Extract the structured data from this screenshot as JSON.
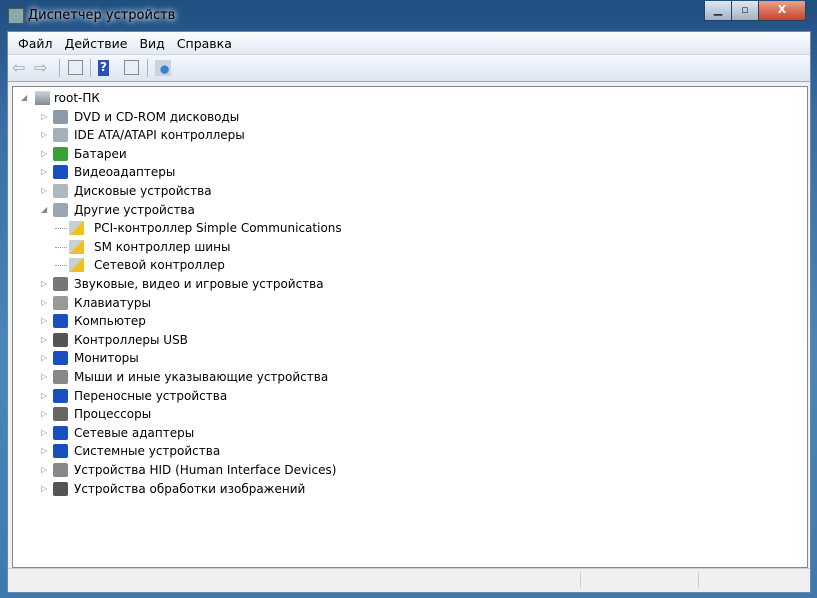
{
  "window": {
    "title": "Диспетчер устройств"
  },
  "menu": [
    "Файл",
    "Действие",
    "Вид",
    "Справка"
  ],
  "toolbar": {
    "icons": [
      "back-icon",
      "forward-icon",
      "console-tree-icon",
      "help-icon",
      "action-pane-icon",
      "scan-hardware-icon"
    ]
  },
  "tree": {
    "root": "root-ПК",
    "items": [
      {
        "label": "DVD и CD-ROM дисководы",
        "icon": "dvd",
        "color": "#8a9aa8"
      },
      {
        "label": "IDE ATA/ATAPI контроллеры",
        "icon": "ide",
        "color": "#a6b0b8"
      },
      {
        "label": "Батареи",
        "icon": "battery",
        "color": "#3aa03a"
      },
      {
        "label": "Видеоадаптеры",
        "icon": "display",
        "color": "#1a4fc0"
      },
      {
        "label": "Дисковые устройства",
        "icon": "disk",
        "color": "#b0b8bf"
      },
      {
        "label": "Другие устройства",
        "icon": "unknown",
        "color": "#9aa6b0",
        "expanded": true,
        "children": [
          "PCI-контроллер Simple Communications",
          "SM контроллер шины",
          "Сетевой контроллер"
        ]
      },
      {
        "label": "Звуковые, видео и игровые устройства",
        "icon": "sound",
        "color": "#777"
      },
      {
        "label": "Клавиатуры",
        "icon": "keyboard",
        "color": "#999"
      },
      {
        "label": "Компьютер",
        "icon": "computer",
        "color": "#1a4fc0"
      },
      {
        "label": "Контроллеры USB",
        "icon": "usb",
        "color": "#555"
      },
      {
        "label": "Мониторы",
        "icon": "monitor",
        "color": "#1a4fc0"
      },
      {
        "label": "Мыши и иные указывающие устройства",
        "icon": "mouse",
        "color": "#888"
      },
      {
        "label": "Переносные устройства",
        "icon": "portable",
        "color": "#1a4fc0"
      },
      {
        "label": "Процессоры",
        "icon": "cpu",
        "color": "#666"
      },
      {
        "label": "Сетевые адаптеры",
        "icon": "network",
        "color": "#1a4fc0"
      },
      {
        "label": "Системные устройства",
        "icon": "system",
        "color": "#1a4fc0"
      },
      {
        "label": "Устройства HID (Human Interface Devices)",
        "icon": "hid",
        "color": "#888"
      },
      {
        "label": "Устройства обработки изображений",
        "icon": "imaging",
        "color": "#555"
      }
    ]
  }
}
